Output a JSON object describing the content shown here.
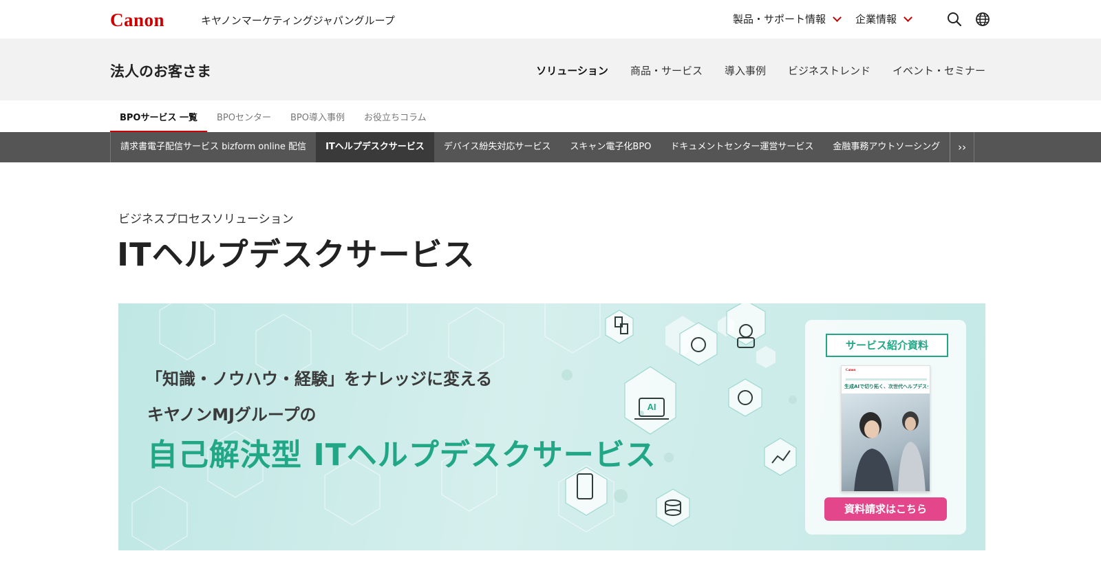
{
  "header": {
    "logo": "Canon",
    "group_name": "キヤノンマーケティングジャパングループ",
    "nav": [
      {
        "label": "製品・サポート情報"
      },
      {
        "label": "企業情報"
      }
    ],
    "icons": [
      "search-icon",
      "globe-icon"
    ]
  },
  "band": {
    "title": "法人のお客さま",
    "nav": [
      {
        "label": "ソリューション",
        "active": true
      },
      {
        "label": "商品・サービス"
      },
      {
        "label": "導入事例"
      },
      {
        "label": "ビジネストレンド"
      },
      {
        "label": "イベント・セミナー"
      }
    ]
  },
  "subtabs": [
    {
      "label": "BPOサービス 一覧",
      "active": true
    },
    {
      "label": "BPOセンター"
    },
    {
      "label": "BPO導入事例"
    },
    {
      "label": "お役立ちコラム"
    }
  ],
  "services": {
    "items": [
      {
        "label": "請求書電子配信サービス bizform online 配信"
      },
      {
        "label": "ITヘルプデスクサービス",
        "active": true
      },
      {
        "label": "デバイス紛失対応サービス"
      },
      {
        "label": "スキャン電子化BPO"
      },
      {
        "label": "ドキュメントセンター運営サービス"
      },
      {
        "label": "金融事務アウトソーシング"
      }
    ],
    "more": "››"
  },
  "page": {
    "eyebrow": "ビジネスプロセスソリューション",
    "title": "ITヘルプデスクサービス"
  },
  "banner": {
    "line1": "「知識・ノウハウ・経験」をナレッジに変える",
    "line2": "キヤノンMJグループの",
    "line3": "自己解決型 ITヘルプデスクサービス",
    "ai_label": "AI",
    "card": {
      "label": "サービス紹介資料",
      "doc_logo": "Canon",
      "doc_title": "生成AIで切り拓く、次世代ヘルプデスク",
      "cta": "資料請求はこちら"
    },
    "colors": {
      "accent": "#22a786",
      "cta": "#e3468a",
      "brand": "#cc0000"
    }
  }
}
